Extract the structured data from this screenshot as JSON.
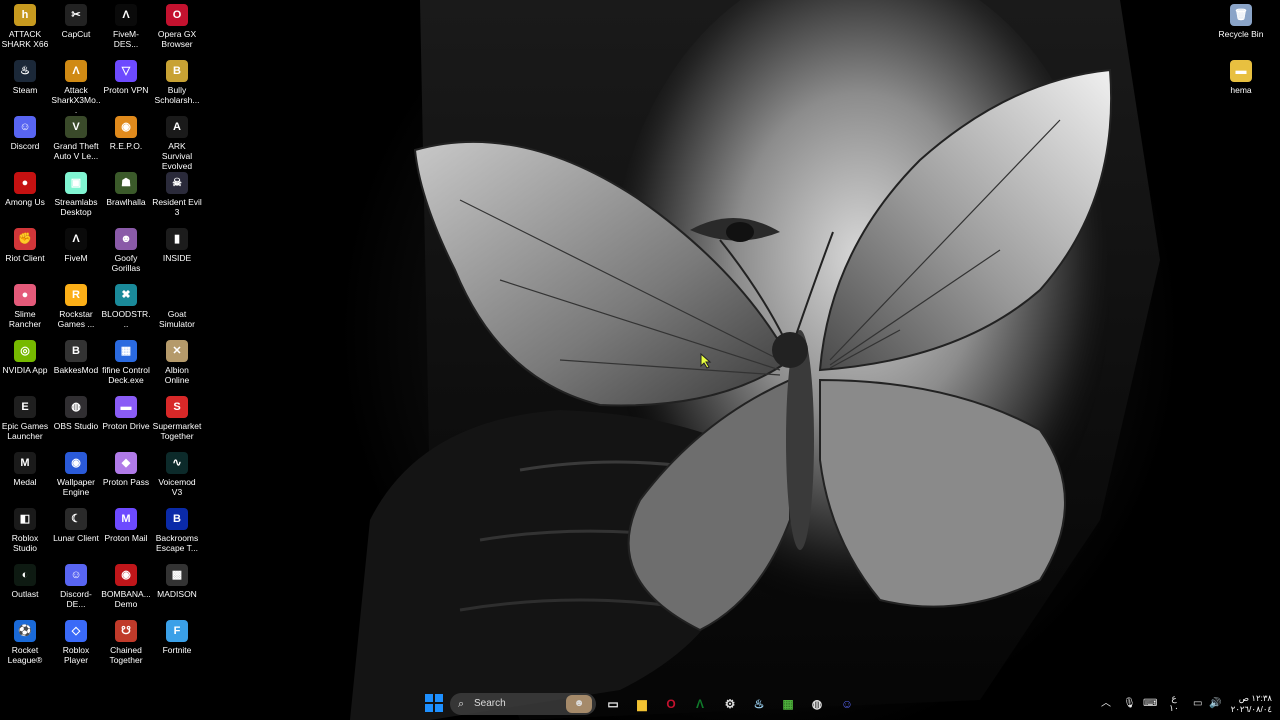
{
  "desktop": {
    "left_icons": [
      {
        "label": "ATTACK SHARK X66",
        "icon": "hema-logo-icon",
        "color": "#c79a1f",
        "glyph": "h"
      },
      {
        "label": "CapCut",
        "icon": "capcut-icon",
        "color": "#222222",
        "glyph": "✂"
      },
      {
        "label": "FiveM-DES...",
        "icon": "fivem-icon",
        "color": "#0a0a0a",
        "glyph": "Λ"
      },
      {
        "label": "Opera GX Browser",
        "icon": "opera-gx-icon",
        "color": "#c4122f",
        "glyph": "O"
      },
      {
        "label": "Steam",
        "icon": "steam-icon",
        "color": "#1b2838",
        "glyph": "♨"
      },
      {
        "label": "Attack SharkX3Mo...",
        "icon": "attack-shark-icon",
        "color": "#d08a14",
        "glyph": "Λ"
      },
      {
        "label": "Proton VPN",
        "icon": "proton-vpn-icon",
        "color": "#6d4aff",
        "glyph": "▽"
      },
      {
        "label": "Bully Scholarsh...",
        "icon": "bully-icon",
        "color": "#c8a234",
        "glyph": "B"
      },
      {
        "label": "Discord",
        "icon": "discord-icon",
        "color": "#5865f2",
        "glyph": "☺"
      },
      {
        "label": "Grand Theft Auto V Le...",
        "icon": "gta-v-icon",
        "color": "#3a4a2a",
        "glyph": "V"
      },
      {
        "label": "R.E.P.O.",
        "icon": "repo-icon",
        "color": "#e08a1c",
        "glyph": "◉"
      },
      {
        "label": "ARK Survival Evolved",
        "icon": "ark-icon",
        "color": "#1a1a1a",
        "glyph": "A"
      },
      {
        "label": "Among Us",
        "icon": "among-us-icon",
        "color": "#c51111",
        "glyph": "●"
      },
      {
        "label": "Streamlabs Desktop",
        "icon": "streamlabs-icon",
        "color": "#80f5d2",
        "glyph": "▣"
      },
      {
        "label": "Brawlhalla",
        "icon": "brawlhalla-icon",
        "color": "#3b5a2a",
        "glyph": "☗"
      },
      {
        "label": "Resident Evil 3",
        "icon": "resident-evil-icon",
        "color": "#2a2a3a",
        "glyph": "☠"
      },
      {
        "label": "Riot Client",
        "icon": "riot-client-icon",
        "color": "#d13639",
        "glyph": "✊"
      },
      {
        "label": "FiveM",
        "icon": "fivem-icon",
        "color": "#0a0a0a",
        "glyph": "Λ"
      },
      {
        "label": "Goofy Gorillas",
        "icon": "goofy-gorillas-icon",
        "color": "#8a5aa8",
        "glyph": "☻"
      },
      {
        "label": "INSIDE",
        "icon": "inside-icon",
        "color": "#1c1c1c",
        "glyph": "▮"
      },
      {
        "label": "Slime Rancher",
        "icon": "slime-rancher-icon",
        "color": "#e45a7a",
        "glyph": "●"
      },
      {
        "label": "Rockstar Games ...",
        "icon": "rockstar-icon",
        "color": "#fcaf17",
        "glyph": "R"
      },
      {
        "label": "BLOODSTR...",
        "icon": "bloodstrike-icon",
        "color": "#1a8a9a",
        "glyph": "✖"
      },
      {
        "label": "Goat Simulator",
        "icon": "goat-simulator-icon",
        "color": "#000000",
        "glyph": ""
      },
      {
        "label": "NVIDIA App",
        "icon": "nvidia-icon",
        "color": "#76b900",
        "glyph": "◎"
      },
      {
        "label": "BakkesMod",
        "icon": "bakkesmod-icon",
        "color": "#333333",
        "glyph": "B"
      },
      {
        "label": "fifine Control Deck.exe",
        "icon": "fifine-icon",
        "color": "#2a6ae0",
        "glyph": "▦"
      },
      {
        "label": "Albion Online",
        "icon": "albion-icon",
        "color": "#b59a6a",
        "glyph": "✕"
      },
      {
        "label": "Epic Games Launcher",
        "icon": "epic-games-icon",
        "color": "#1f1f1f",
        "glyph": "E"
      },
      {
        "label": "OBS Studio",
        "icon": "obs-icon",
        "color": "#302e31",
        "glyph": "◍"
      },
      {
        "label": "Proton Drive",
        "icon": "proton-drive-icon",
        "color": "#8a5cf6",
        "glyph": "▬"
      },
      {
        "label": "Supermarket Together",
        "icon": "supermarket-icon",
        "color": "#d82828",
        "glyph": "S"
      },
      {
        "label": "Medal",
        "icon": "medal-icon",
        "color": "#1a1a1a",
        "glyph": "M"
      },
      {
        "label": "Wallpaper Engine",
        "icon": "wallpaper-engine-icon",
        "color": "#2a5ad8",
        "glyph": "◉"
      },
      {
        "label": "Proton Pass",
        "icon": "proton-pass-icon",
        "color": "#b07ae8",
        "glyph": "◆"
      },
      {
        "label": "Voicemod V3",
        "icon": "voicemod-icon",
        "color": "#0c2a2a",
        "glyph": "∿"
      },
      {
        "label": "Roblox Studio",
        "icon": "roblox-studio-icon",
        "color": "#1a1a1a",
        "glyph": "◧"
      },
      {
        "label": "Lunar Client",
        "icon": "lunar-client-icon",
        "color": "#2a2a2a",
        "glyph": "☾"
      },
      {
        "label": "Proton Mail",
        "icon": "proton-mail-icon",
        "color": "#6d4aff",
        "glyph": "M"
      },
      {
        "label": "Backrooms Escape T...",
        "icon": "backrooms-icon",
        "color": "#0a2aa8",
        "glyph": "B"
      },
      {
        "label": "Outlast",
        "icon": "outlast-icon",
        "color": "#0e1a12",
        "glyph": "◐"
      },
      {
        "label": "Discord-DE...",
        "icon": "discord-icon",
        "color": "#5865f2",
        "glyph": "☺"
      },
      {
        "label": "BOMBANA... Demo",
        "icon": "bombana-icon",
        "color": "#c0161a",
        "glyph": "◉"
      },
      {
        "label": "MADISON",
        "icon": "madison-icon",
        "color": "#333333",
        "glyph": "▩"
      },
      {
        "label": "Rocket League®",
        "icon": "rocket-league-icon",
        "color": "#1a6ad8",
        "glyph": "⚽"
      },
      {
        "label": "Roblox Player",
        "icon": "roblox-player-icon",
        "color": "#3a6af8",
        "glyph": "◇"
      },
      {
        "label": "Chained Together",
        "icon": "chained-together-icon",
        "color": "#c03a2a",
        "glyph": "☋"
      },
      {
        "label": "Fortnite",
        "icon": "fortnite-icon",
        "color": "#3aa0e8",
        "glyph": "F"
      }
    ],
    "right_icons": [
      {
        "label": "Recycle Bin",
        "icon": "recycle-bin-icon",
        "color": "#8aa4c8",
        "glyph": "🗑"
      },
      {
        "label": "hema",
        "icon": "folder-icon",
        "color": "#e8c040",
        "glyph": "▬"
      }
    ]
  },
  "taskbar": {
    "start": {
      "icon": "windows-start-icon",
      "color": "#1e90ff"
    },
    "search": {
      "placeholder": "Search",
      "icon": "search-icon"
    },
    "pinned": [
      {
        "icon": "task-view-icon",
        "glyph": "▭",
        "color": "#e8e8e8"
      },
      {
        "icon": "file-explorer-icon",
        "glyph": "▆",
        "color": "#f2c232"
      },
      {
        "icon": "opera-gx-icon",
        "glyph": "O",
        "color": "#c4122f"
      },
      {
        "icon": "fivem-icon",
        "glyph": "Λ",
        "color": "#0f7a2a"
      },
      {
        "icon": "settings-icon",
        "glyph": "⚙",
        "color": "#dddddd"
      },
      {
        "icon": "steam-icon",
        "glyph": "♨",
        "color": "#9ad0f0"
      },
      {
        "icon": "minecraft-icon",
        "glyph": "▦",
        "color": "#4caf3a"
      },
      {
        "icon": "obs-icon",
        "glyph": "◍",
        "color": "#dddddd"
      },
      {
        "icon": "discord-icon",
        "glyph": "☺",
        "color": "#5865f2"
      }
    ],
    "tray": {
      "icons": [
        "chevron-up-icon",
        "microphone-icon",
        "keyboard-icon"
      ],
      "input_language": "ع",
      "input_sub": "١٠",
      "network_icon": "network-icon",
      "volume_icon": "volume-icon",
      "battery_icon": "battery-icon"
    },
    "clock": {
      "time": "١٢:٣٨ ص",
      "date": "٢٠٢٦/٠٨/٠٤"
    }
  }
}
